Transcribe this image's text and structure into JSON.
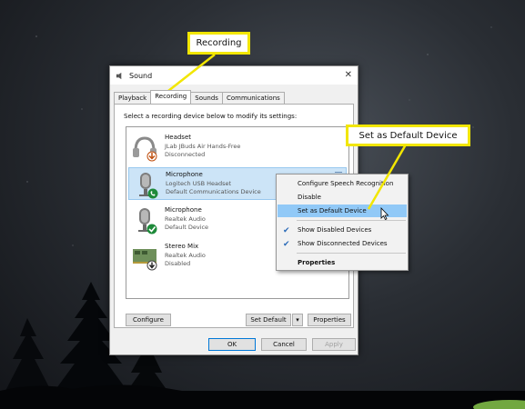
{
  "callouts": {
    "recording": "Recording",
    "set_default": "Set as Default Device"
  },
  "dialog": {
    "title": "Sound",
    "tabs": [
      "Playback",
      "Recording",
      "Sounds",
      "Communications"
    ],
    "active_tab": "Recording",
    "instruction": "Select a recording device below to modify its settings:",
    "devices": [
      {
        "name": "Headset",
        "description": "JLab JBuds Air Hands-Free",
        "status": "Disconnected",
        "icon": "headset-icon",
        "badge": "down-arrow"
      },
      {
        "name": "Microphone",
        "description": "Logitech USB Headset",
        "status": "Default Communications Device",
        "icon": "microphone-icon",
        "badge": "phone",
        "selected": true
      },
      {
        "name": "Microphone",
        "description": "Realtek Audio",
        "status": "Default Device",
        "icon": "microphone-icon",
        "badge": "check"
      },
      {
        "name": "Stereo Mix",
        "description": "Realtek Audio",
        "status": "Disabled",
        "icon": "sound-card-icon",
        "badge": "down-arrow"
      }
    ],
    "buttons": {
      "configure": "Configure",
      "set_default": "Set Default",
      "properties": "Properties",
      "ok": "OK",
      "cancel": "Cancel",
      "apply": "Apply"
    }
  },
  "context_menu": {
    "items": [
      {
        "label": "Configure Speech Recognition"
      },
      {
        "label": "Disable"
      },
      {
        "label": "Set as Default Device",
        "hover": true
      },
      {
        "label": "Show Disabled Devices",
        "checked": true
      },
      {
        "label": "Show Disconnected Devices",
        "checked": true
      },
      {
        "label": "Properties",
        "bold": true
      }
    ]
  },
  "colors": {
    "callout_border": "#f2e600",
    "menu_hover": "#91c9f7",
    "selected_row": "#cce4f7",
    "badge_green": "#1e8a3a"
  }
}
